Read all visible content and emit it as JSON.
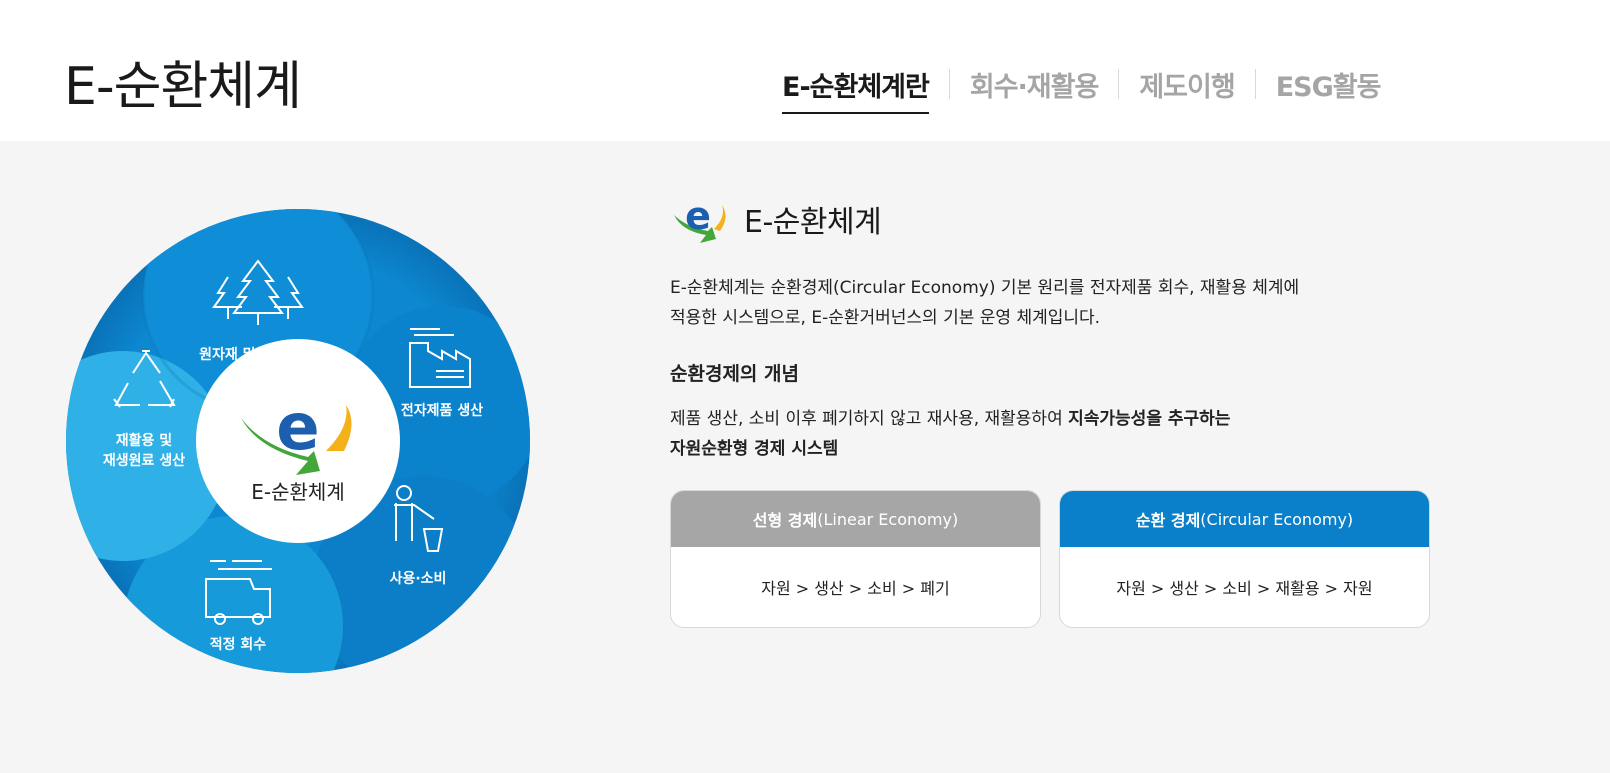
{
  "header": {
    "title": "E-순환체계",
    "tabs": [
      {
        "label": "E-순환체계란",
        "active": true
      },
      {
        "label": "회수·재활용",
        "active": false
      },
      {
        "label": "제도이행",
        "active": false
      },
      {
        "label": "ESG활동",
        "active": false
      }
    ]
  },
  "cycle": {
    "center_label": "E-순환체계",
    "segments": [
      {
        "label": "원자재 및 재생 원료",
        "icon": "trees-icon"
      },
      {
        "label": "전자제품 생산",
        "icon": "factory-icon"
      },
      {
        "label": "사용·소비",
        "icon": "disposal-person-icon"
      },
      {
        "label": "적정 회수",
        "icon": "truck-icon"
      },
      {
        "label_line1": "재활용 및",
        "label_line2": "재생원료 생산",
        "icon": "recycle-icon"
      }
    ]
  },
  "info": {
    "title": "E-순환체계",
    "desc_line1": "E-순환체계는 순환경제(Circular Economy) 기본 원리를 전자제품 회수, 재활용 체계에",
    "desc_line2": "적용한 시스템으로, E-순환거버넌스의 기본 운영 체계입니다.",
    "concept_heading": "순환경제의 개념",
    "concept_plain": "제품 생산, 소비 이후 폐기하지 않고 재사용, 재활용하여 ",
    "concept_bold1": "지속가능성을 추구하는",
    "concept_bold2": "자원순환형 경제 시스템"
  },
  "cards": {
    "linear": {
      "title_bold": "선형 경제",
      "title_rest": "(Linear Economy)",
      "flow": "자원 > 생산 > 소비 > 폐기"
    },
    "circular": {
      "title_bold": "순환 경제",
      "title_rest": "(Circular Economy)",
      "flow": "자원 > 생산 > 소비 > 재활용 > 자원"
    }
  },
  "colors": {
    "brand_blue": "#0a7fca",
    "light_blue": "#29a8e0",
    "gray_header": "#a6a6a6",
    "logo_green": "#43a63a",
    "logo_yellow": "#f4b11a"
  }
}
